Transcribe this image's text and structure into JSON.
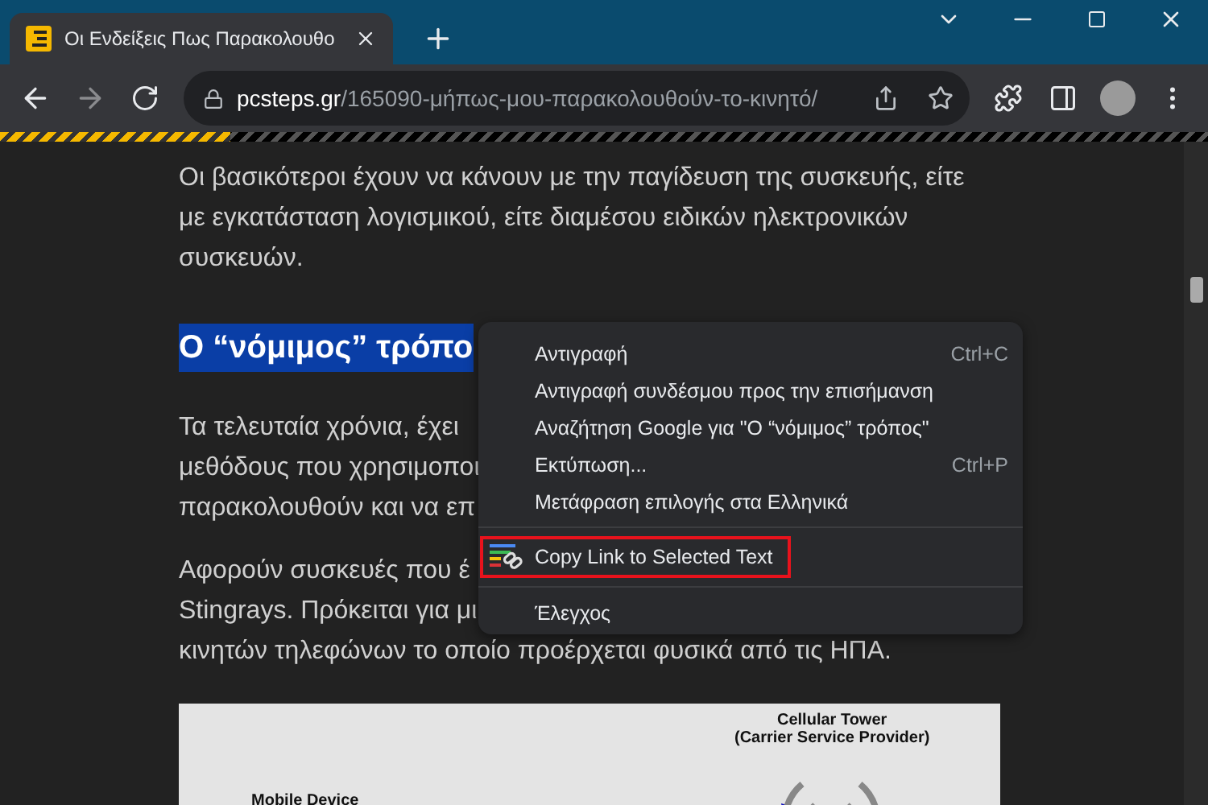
{
  "browser": {
    "tab": {
      "title": "Οι Ενδείξεις Πως Παρακολουθο",
      "selected": true
    },
    "address": {
      "domain": "pcsteps.gr",
      "path": "/165090-μήπως-μου-παρακολουθούν-το-κινητό/"
    },
    "reading_progress": {
      "level": 0.19
    }
  },
  "article": {
    "blocks": [
      {
        "kind": "paragraph",
        "lines": [
          "Οι βασικότεροι έχουν να κάνουν με την παγίδευση της συσκευής, είτε",
          "με εγκατάσταση λογισμικού, είτε διαμέσου ειδικών ηλεκτρονικών",
          "συσκευών."
        ]
      },
      {
        "kind": "heading",
        "text": "Ο “νόμιμος” τρόπο",
        "selected": true
      },
      {
        "kind": "paragraph",
        "lines": [
          "Τα τελευταία χρόνια, έχει",
          "μεθόδους που χρησιμοποι",
          "παρακολουθούν και να επ"
        ]
      },
      {
        "kind": "paragraph",
        "lines": [
          "Αφορούν συσκευές που έ",
          "Stingrays. Πρόκειται για μι",
          "κινητών τηλεφώνων το οποίο προέρχεται φυσικά από τις ΗΠΑ."
        ]
      }
    ],
    "diagram": {
      "tower_label": [
        "Cellular Tower",
        "(Carrier Service Provider)"
      ],
      "device_label": "Mobile Device"
    }
  },
  "context_menu": {
    "items": [
      {
        "kind": "item",
        "label": "Αντιγραφή",
        "shortcut": "Ctrl+C",
        "highlighted": false
      },
      {
        "kind": "item",
        "label": "Αντιγραφή συνδέσμου προς την επισήμανση",
        "highlighted": false
      },
      {
        "kind": "item",
        "label": "Αναζήτηση Google για \"Ο “νόμιμος” τρόπος\"",
        "highlighted": false
      },
      {
        "kind": "item",
        "label": "Εκτύπωση...",
        "shortcut": "Ctrl+P",
        "highlighted": false
      },
      {
        "kind": "item",
        "label": "Μετάφραση επιλογής στα Ελληνικά",
        "highlighted": false
      },
      {
        "kind": "separator"
      },
      {
        "kind": "extension",
        "label": "Copy Link to Selected Text",
        "highlighted": true
      },
      {
        "kind": "separator"
      },
      {
        "kind": "item",
        "label": "Έλεγχος",
        "highlighted": false
      }
    ]
  }
}
